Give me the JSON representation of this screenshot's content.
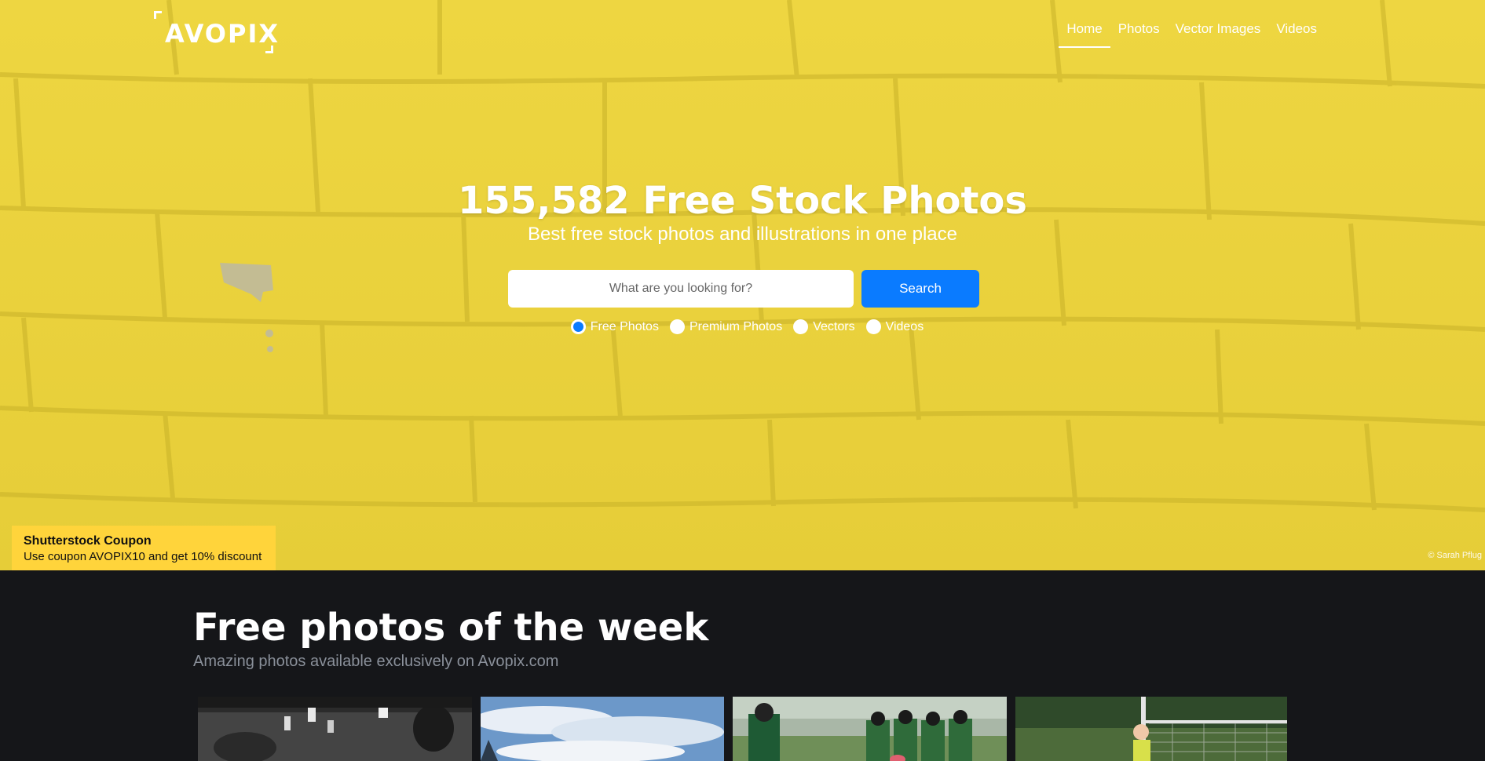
{
  "brand": {
    "logo_text": "AVOPIX"
  },
  "nav": {
    "items": [
      {
        "label": "Home",
        "active": true
      },
      {
        "label": "Photos",
        "active": false
      },
      {
        "label": "Vector Images",
        "active": false
      },
      {
        "label": "Videos",
        "active": false
      }
    ]
  },
  "hero": {
    "title": "155,582 Free Stock Photos",
    "subtitle": "Best free stock photos and illustrations in one place",
    "search_placeholder": "What are you looking for?",
    "search_button": "Search",
    "radio_options": [
      {
        "label": "Free Photos",
        "checked": true
      },
      {
        "label": "Premium Photos",
        "checked": false
      },
      {
        "label": "Vectors",
        "checked": false
      },
      {
        "label": "Videos",
        "checked": false
      }
    ],
    "credit": "© Sarah Pflug"
  },
  "coupon": {
    "title": "Shutterstock Coupon",
    "text": "Use coupon AVOPIX10 and get 10% discount"
  },
  "section": {
    "title": "Free photos of the week",
    "subtitle": "Amazing photos available exclusively on Avopix.com"
  },
  "colors": {
    "hero_yellow": "#e9d23e",
    "accent_blue": "#0a7bff",
    "coupon_yellow": "#ffd43b",
    "dark_bg": "#151619"
  }
}
